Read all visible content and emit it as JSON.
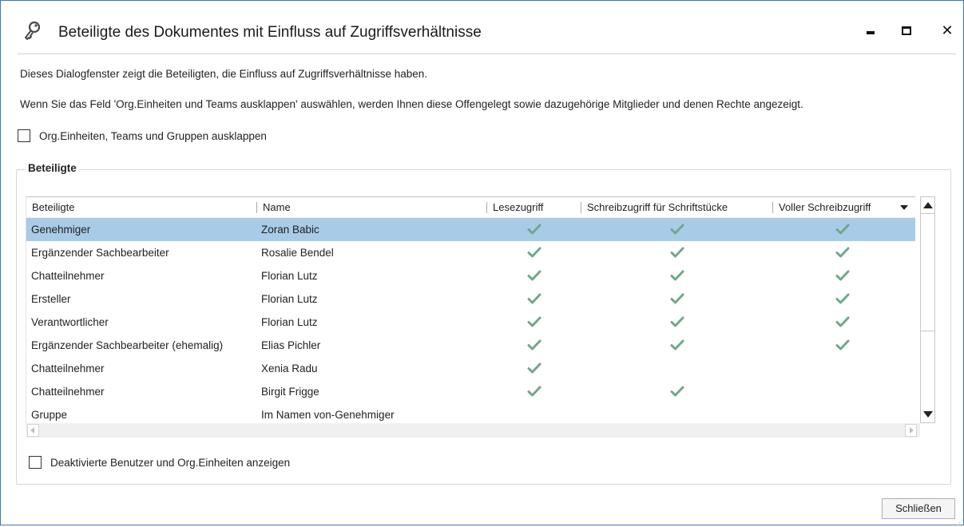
{
  "window": {
    "title": "Beteiligte des Dokumentes mit Einfluss auf Zugriffsverhältnisse",
    "icon": "key-icon",
    "controls": {
      "minimize": "minimize",
      "maximize": "maximize",
      "close": "✕"
    }
  },
  "info": {
    "line1": "Dieses Dialogfenster zeigt die Beteiligten, die Einfluss auf Zugriffsverhältnisse haben.",
    "line2": "Wenn Sie das Feld 'Org.Einheiten und Teams ausklappen' auswählen, werden Ihnen diese Offengelegt sowie dazugehörige Mitglieder und denen Rechte angezeigt."
  },
  "expand_checkbox": {
    "label": "Org.Einheiten, Teams und Gruppen ausklappen",
    "checked": false
  },
  "group": {
    "title": "Beteiligte",
    "columns": [
      "Beteiligte",
      "Name",
      "Lesezugriff",
      "Schreibzugriff für Schriftstücke",
      "Voller Schreibzugriff"
    ],
    "rows": [
      {
        "role": "Genehmiger",
        "name": "Zoran Babic",
        "read": true,
        "write_docs": true,
        "full_write": true,
        "selected": true
      },
      {
        "role": "Ergänzender Sachbearbeiter",
        "name": "Rosalie Bendel",
        "read": true,
        "write_docs": true,
        "full_write": true,
        "selected": false
      },
      {
        "role": "Chatteilnehmer",
        "name": "Florian Lutz",
        "read": true,
        "write_docs": true,
        "full_write": true,
        "selected": false
      },
      {
        "role": "Ersteller",
        "name": "Florian Lutz",
        "read": true,
        "write_docs": true,
        "full_write": true,
        "selected": false
      },
      {
        "role": "Verantwortlicher",
        "name": "Florian Lutz",
        "read": true,
        "write_docs": true,
        "full_write": true,
        "selected": false
      },
      {
        "role": "Ergänzender Sachbearbeiter (ehemalig)",
        "name": "Elias Pichler",
        "read": true,
        "write_docs": true,
        "full_write": true,
        "selected": false
      },
      {
        "role": "Chatteilnehmer",
        "name": "Xenia Radu",
        "read": true,
        "write_docs": false,
        "full_write": false,
        "selected": false
      },
      {
        "role": "Chatteilnehmer",
        "name": "Birgit Frigge",
        "read": true,
        "write_docs": true,
        "full_write": false,
        "selected": false
      },
      {
        "role": "Gruppe",
        "name": "Im Namen von-Genehmiger",
        "read": false,
        "write_docs": false,
        "full_write": false,
        "selected": false
      }
    ]
  },
  "deactivated_checkbox": {
    "label": "Deaktivierte Benutzer und Org.Einheiten anzeigen",
    "checked": false
  },
  "close_button": {
    "label": "Schließen"
  },
  "colors": {
    "selected_row": "#a8cbe8",
    "checkmark": "#6fa88a",
    "border_accent": "#3b79b7"
  }
}
